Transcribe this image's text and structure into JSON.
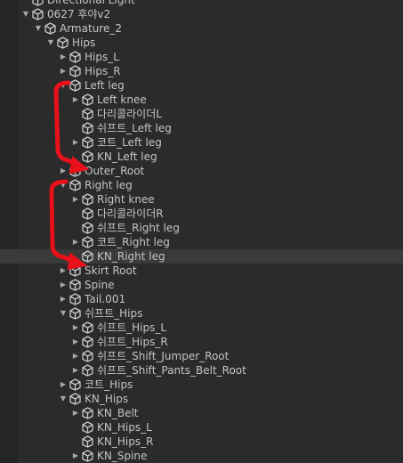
{
  "hierarchy": {
    "rows": [
      {
        "label": "Directional Light",
        "depth": 2,
        "arrow": "none",
        "icon": "gameobject-icon"
      },
      {
        "label": "0627 후야v2",
        "depth": 2,
        "arrow": "down",
        "icon": "gameobject-icon"
      },
      {
        "label": "Armature_2",
        "depth": 3,
        "arrow": "down",
        "icon": "gameobject-icon"
      },
      {
        "label": "Hips",
        "depth": 4,
        "arrow": "down",
        "icon": "gameobject-icon"
      },
      {
        "label": "Hips_L",
        "depth": 5,
        "arrow": "right",
        "icon": "gameobject-icon"
      },
      {
        "label": "Hips_R",
        "depth": 5,
        "arrow": "right",
        "icon": "gameobject-icon"
      },
      {
        "label": "Left leg",
        "depth": 5,
        "arrow": "down",
        "icon": "gameobject-icon"
      },
      {
        "label": "Left knee",
        "depth": 6,
        "arrow": "right",
        "icon": "gameobject-icon"
      },
      {
        "label": "다리콜라이더L",
        "depth": 6,
        "arrow": "none",
        "icon": "gameobject-icon"
      },
      {
        "label": "쉬프트_Left leg",
        "depth": 6,
        "arrow": "none",
        "icon": "gameobject-icon"
      },
      {
        "label": "코트_Left leg",
        "depth": 6,
        "arrow": "right",
        "icon": "gameobject-icon"
      },
      {
        "label": "KN_Left leg",
        "depth": 6,
        "arrow": "none",
        "icon": "gameobject-icon"
      },
      {
        "label": "Outer_Root",
        "depth": 5,
        "arrow": "right",
        "icon": "gameobject-icon"
      },
      {
        "label": "Right leg",
        "depth": 5,
        "arrow": "down",
        "icon": "gameobject-icon"
      },
      {
        "label": "Right knee",
        "depth": 6,
        "arrow": "right",
        "icon": "gameobject-icon"
      },
      {
        "label": "다리콜라이더R",
        "depth": 6,
        "arrow": "none",
        "icon": "gameobject-icon"
      },
      {
        "label": "쉬프트_Right leg",
        "depth": 6,
        "arrow": "none",
        "icon": "gameobject-icon"
      },
      {
        "label": "코트_Right leg",
        "depth": 6,
        "arrow": "right",
        "icon": "gameobject-icon"
      },
      {
        "label": "KN_Right leg",
        "depth": 6,
        "arrow": "none",
        "icon": "gameobject-icon",
        "highlighted": true
      },
      {
        "label": "Skirt Root",
        "depth": 5,
        "arrow": "right",
        "icon": "gameobject-icon"
      },
      {
        "label": "Spine",
        "depth": 5,
        "arrow": "right",
        "icon": "gameobject-icon"
      },
      {
        "label": "Tail.001",
        "depth": 5,
        "arrow": "right",
        "icon": "gameobject-icon"
      },
      {
        "label": "쉬프트_Hips",
        "depth": 5,
        "arrow": "down",
        "icon": "gameobject-icon"
      },
      {
        "label": "쉬프트_Hips_L",
        "depth": 6,
        "arrow": "right",
        "icon": "gameobject-icon"
      },
      {
        "label": "쉬프트_Hips_R",
        "depth": 6,
        "arrow": "right",
        "icon": "gameobject-icon"
      },
      {
        "label": "쉬프트_Shift_Jumper_Root",
        "depth": 6,
        "arrow": "right",
        "icon": "gameobject-icon"
      },
      {
        "label": "쉬프트_Shift_Pants_Belt_Root",
        "depth": 6,
        "arrow": "right",
        "icon": "gameobject-icon"
      },
      {
        "label": "코트_Hips",
        "depth": 5,
        "arrow": "right",
        "icon": "gameobject-icon"
      },
      {
        "label": "KN_Hips",
        "depth": 5,
        "arrow": "down",
        "icon": "gameobject-icon"
      },
      {
        "label": "KN_Belt",
        "depth": 6,
        "arrow": "right",
        "icon": "gameobject-icon"
      },
      {
        "label": "KN_Hips_L",
        "depth": 6,
        "arrow": "none",
        "icon": "gameobject-icon"
      },
      {
        "label": "KN_Hips_R",
        "depth": 6,
        "arrow": "none",
        "icon": "gameobject-icon"
      },
      {
        "label": "KN_Spine",
        "depth": 6,
        "arrow": "right",
        "icon": "gameobject-icon"
      },
      {
        "label": "",
        "depth": 5,
        "arrow": "right",
        "icon": "gameobject-icon"
      }
    ]
  },
  "annotation_color": "#e8101a"
}
